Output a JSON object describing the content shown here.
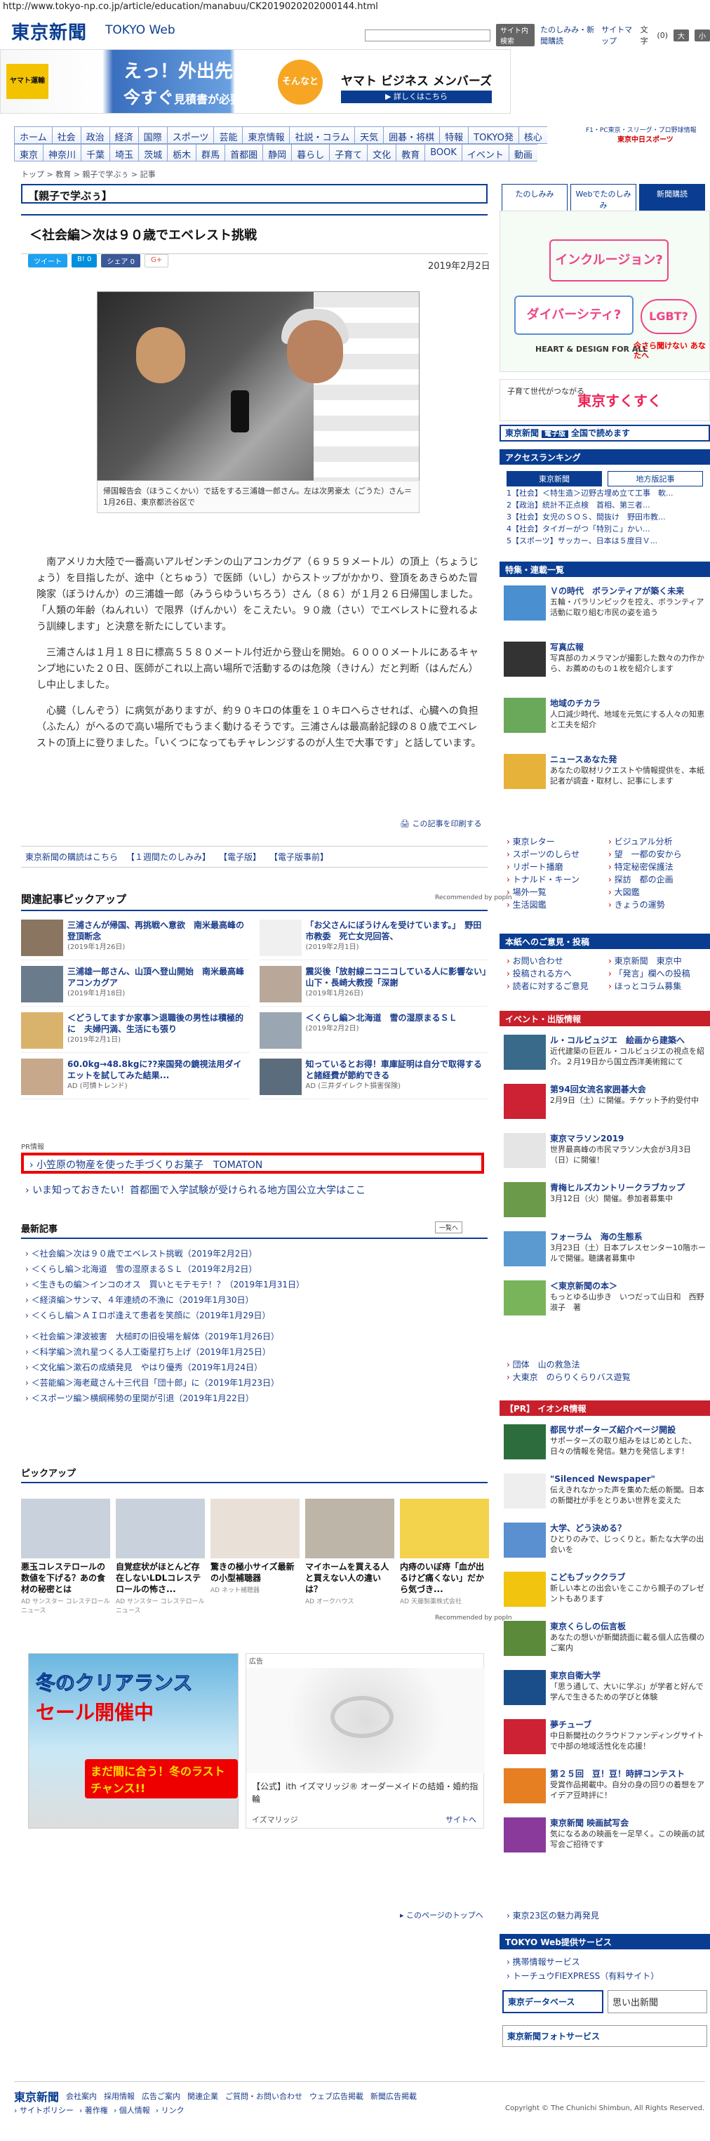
{
  "url": "http://www.tokyo-np.co.jp/article/education/manabuu/CK2019020202000144.html",
  "header": {
    "logo": "東京新聞",
    "logo_sub": "TOKYO Web",
    "search_btn": "サイト内検索",
    "links": [
      "たのしみみ・新聞購読",
      "サイトマップ",
      "文字",
      "大",
      "小"
    ],
    "font_size_count": "(0)"
  },
  "ad_top": {
    "brand": "ヤマト運輸",
    "line1": "えっ！外出先なのに、",
    "line2": "今すぐ",
    "line2b": "見積書が必要!?",
    "badge": "そんなときは...",
    "right": "ヤマト ビジネス メンバーズ",
    "cta": "▶ 詳しくはこちら"
  },
  "nav": {
    "row1": [
      "ホーム",
      "社会",
      "政治",
      "経済",
      "国際",
      "スポーツ",
      "芸能",
      "東京情報",
      "社説・コラム",
      "天気",
      "囲碁・将棋",
      "特報",
      "TOKYO発",
      "核心"
    ],
    "row2": [
      "東京",
      "神奈川",
      "千葉",
      "埼玉",
      "茨城",
      "栃木",
      "群馬",
      "首都圏",
      "静岡",
      "暮らし",
      "子育て",
      "文化",
      "教育",
      "BOOK",
      "イベント",
      "動画"
    ],
    "side": "F1・PC東京・スリーグ・プロ野球情報",
    "chunichi": "東京中日スポーツ"
  },
  "breadcrumb": "トップ > 教育 > 親子で学ぶぅ > 記事",
  "section_title": "【親子で学ぶぅ】",
  "right_tabs": [
    "たのしみみ",
    "Webでたのしみみ",
    "新聞購読"
  ],
  "article": {
    "title": "＜社会編＞次は９０歳でエベレスト挑戦",
    "date": "2019年2月2日",
    "share": [
      "ツイート",
      "B! 0",
      "シェア 0",
      "G+"
    ],
    "caption": "帰国報告会（ほうこくかい）で話をする三浦雄一郎さん。左は次男豪太（ごうた）さん＝1月26日、東京都渋谷区で",
    "paragraphs": [
      "南アメリカ大陸で一番高いアルゼンチンの山アコンカグア（６９５９メートル）の頂上（ちょうじょう）を目指したが、途中（とちゅう）で医師（いし）からストップがかかり、登頂をあきらめた冒険家（ぼうけんか）の三浦雄一郎（みうらゆういちろう）さん（８６）が１月２６日帰国しました。「人類の年齢（ねんれい）で限界（げんかい）をこえたい。９０歳（さい）でエベレストに登れるよう訓練します」と決意を新たにしています。",
      "三浦さんは１月１８日に標高５５８０メートル付近から登山を開始。６０００メートルにあるキャンプ地にいた２０日、医師がこれ以上高い場所で活動するのは危険（きけん）だと判断（はんだん）し中止しました。",
      "心臓（しんぞう）に病気がありますが、約９０キロの体重を１０キロへらさせれば、心臓への負担（ふたん）がへるので高い場所でもうまく動けるそうです。三浦さんは最高齢記録の８０歳でエベレストの頂上に登りました。「いくつになってもチャレンジするのが人生で大事です」と話しています。"
    ],
    "print": "この記事を印刷する"
  },
  "subbar": [
    "東京新聞の購読はこちら",
    "【１週間たのしみみ】",
    "【電子版】",
    "【電子版事前】"
  ],
  "pickup": {
    "heading": "関連記事ピックアップ",
    "recommended": "Recommended by popIn",
    "items": [
      {
        "title": "三浦さんが帰国、再挑戦へ意欲　南米最高峰の登頂断念",
        "date": "(2019年1月26日)"
      },
      {
        "title": "「お父さんにぼうけんを受けています。」　野田市教委　死亡女児回答、",
        "date": "(2019年2月1日)"
      },
      {
        "title": "三浦雄一郎さん、山頂へ登山開始　南米最高峰アコンカグア",
        "date": "(2019年1月18日)"
      },
      {
        "title": "震災後「放射線ニコニコしている人に影響ない」　山下・長崎大教授「深謝",
        "date": "(2019年1月26日)"
      },
      {
        "title": "＜どうしてますか家事＞退職後の男性は積極的に　夫婦円満、生活にも張り",
        "date": "(2019年2月1日)"
      },
      {
        "title": "＜くらし編＞北海道　雪の湿原まるＳＬ",
        "date": "(2019年2月2日)"
      },
      {
        "title": "60.0kg→48.8kgに??来国発の鏡視法用ダイエットを試してみた結果...",
        "date": "AD (可憐トレンド)"
      },
      {
        "title": "知っているとお得！車庫証明は自分で取得すると諸経費が節約できる",
        "date": "AD (三井ダイレクト損害保険)"
      }
    ]
  },
  "pr": {
    "label": "PR情報",
    "ad1": "小笠原の物産を使った手づくりお菓子　TOMATON",
    "ad2": "いま知っておきたい！首都圏で入学試験が受けられる地方国公立大学はここ"
  },
  "latest": {
    "heading": "最新記事",
    "more": "一覧へ",
    "items": [
      "＜社会編＞次は９０歳でエベレスト挑戦（2019年2月2日）",
      "＜くらし編＞北海道　雪の湿原まるＳＬ（2019年2月2日）",
      "＜生きもの編＞インコのオス　買いとモテモテ！？（2019年1月31日）",
      "＜経済編＞サンマ、４年連続の不漁に（2019年1月30日）",
      "＜くらし編＞ＡＩロボ逢えて患者を笑顔に（2019年1月29日）",
      "＜社会編＞津波被害　大槌町の旧役場を解体（2019年1月26日）",
      "＜科学編＞流れ星つくる人工衛星打ち上げ（2019年1月25日）",
      "＜文化編＞漱石の成績発見　やはり優秀（2019年1月24日）",
      "＜芸能編＞海老蔵さん十三代目「団十郎」に（2019年1月23日）",
      "＜スポーツ編＞横綱稀勢の里関が引退（2019年1月22日）"
    ]
  },
  "pickup2": {
    "heading": "ピックアップ",
    "recommended": "Recommended by popIn",
    "items": [
      {
        "title": "悪玉コレステロールの数値を下げる？あの食材の秘密とは",
        "src": "AD サンスター コレステロールニュース"
      },
      {
        "title": "自覚症状がほとんど存在しないLDLコレステロールの怖さ...",
        "src": "AD サンスター コレステロールニュース"
      },
      {
        "title": "驚きの極小サイズ最新の小型補聴器",
        "src": "AD ネット補聴器"
      },
      {
        "title": "マイホームを買える人と買えない人の違いは？",
        "src": "AD オークハウス"
      },
      {
        "title": "内痔のいぼ痔「血が出るけど痛くない」だから気づき...",
        "src": "AD 天藤製薬株式会社"
      }
    ]
  },
  "ad_bottom": {
    "left1": "冬のクリアランス",
    "left2": "セール開催中",
    "left3": "まだ間に合う！冬のラストチャンス!!",
    "label": "広告",
    "right_title": "【公式】ith イズマリッジ® オーダーメイドの結婚・婚約指輪",
    "right_sponsor": "イズマリッジ",
    "right_link": "サイトへ"
  },
  "totop": "このページのトップへ",
  "right": {
    "ban1": [
      "インクルージョン?",
      "ダイバーシティ?",
      "LGBT?"
    ],
    "ban1_foot": "HEART & DESIGN FOR ALL",
    "ban1_foot2": "今さら聞けない あなたへ",
    "ban2a": "子育て世代がつながる",
    "ban2b": "東京すくすく",
    "ban3": "東京新聞",
    "ban3x": "電子版",
    "ban3y": "全国で読めます",
    "ranking_h": "アクセスランキング",
    "ranking_tabs": [
      "東京新聞",
      "地方版記事"
    ],
    "ranking": [
      "1【社会】＜特生造＞辺野古埋め立て工事　軟...",
      "2【政治】統計不正点検　首相、第三者...",
      "3【社会】女児のＳＯＳ、間抜け　野田市教...",
      "4【社会】タイガーがつ「特別こ」かい...",
      "5【スポーツ】サッカー、日本は５度目Ｖ..."
    ],
    "special_h": "特集・連載一覧",
    "special": [
      {
        "t": "Ｖの時代　ボランティアが築く未来",
        "d": "五輪・パラリンピックを控え、ボランティア活動に取り組む市民の姿を追う"
      },
      {
        "t": "写真広報",
        "d": "写真部のカメラマンが撮影した数々の力作から、お薦めのもの１枚を紹介します"
      },
      {
        "t": "地域のチカラ",
        "d": "人口減少時代、地域を元気にする人々の知恵と工夫を紹介"
      },
      {
        "t": "ニュースあなた発",
        "d": "あなたの取材リクエストや情報提供を、本紙記者が調査・取材し、記事にします"
      }
    ],
    "links1": [
      "東京レター",
      "ビジュアル分析",
      "スポーツのしらせ",
      "望　一都の安から",
      "リポート播磨",
      "特定秘密保護法",
      "トナルド・キーン",
      "探訪　都の企画",
      "場外一覧",
      "大図鑑",
      "生活図鑑",
      "きょうの運勢"
    ],
    "info_h": "本紙へのご意見・投稿",
    "info": [
      "お問い合わせ",
      "東京新聞　東京中",
      "投稿される方へ",
      "「発言」欄への投稿",
      "読者に対するご意見",
      "ほっとコラム募集"
    ],
    "event_h": "イベント・出版情報",
    "events": [
      {
        "t": "ル・コルビュジエ　絵画から建築へ",
        "d": "近代建築の巨匠ル・コルビュジエの視点を紹介。２月19日から国立西洋美術館にて"
      },
      {
        "t": "第94回女流名家囲碁大会",
        "d": "2月9日（土）に開催。チケット予約受付中"
      },
      {
        "t": "東京マラソン2019",
        "d": "世界最高峰の市民マラソン大会が3月3日（日）に開催！"
      },
      {
        "t": "青梅ヒルズカントリークラブカップ",
        "d": "3月12日（火）開催。参加者募集中"
      },
      {
        "t": "フォーラム　海の生態系",
        "d": "3月23日（土）日本プレスセンター10階ホールで開催。聴講者募集中"
      },
      {
        "t": "＜東京新聞の本＞",
        "d": "もっとゆる山歩き　いつだって山日和　西野淑子　著"
      }
    ],
    "ev_links": [
      "団体　山の救急法",
      "大東京　のらりくらりバス遊覧"
    ],
    "pr_h": "【PR】 イオンR情報",
    "prs": [
      {
        "t": "都民サポーターズ紹介ページ開設",
        "d": "サポーターズの取り組みをはじめとした、日々の情報を発信。魅力を発信します！"
      },
      {
        "t": "\"Silenced Newspaper\"",
        "d": "伝えきれなかった声を集めた紙の新聞。日本の新聞社が手をとりあい世界を変えた"
      },
      {
        "t": "大学、どう決める？",
        "d": "ひとりのみで、じっくりと。新たな大学の出会いを"
      },
      {
        "t": "こどもブッククラブ",
        "d": "新しい本との出会いをここから親子のプレゼントもあります"
      },
      {
        "t": "東京くらしの伝言板",
        "d": "あなたの想いが新聞読面に載る個人広告欄のご案内"
      },
      {
        "t": "東京自衛大学",
        "d": "「思う通して、大いに学ぶ」が学者と好んで学んで生きるための学びと体験"
      },
      {
        "t": "夢チューブ",
        "d": "中日新聞社のクラウドファンディングサイトで中部の地域活性化を応援！"
      },
      {
        "t": "第２５回　豆！豆！時評コンテスト",
        "d": "受賞作品掲載中。自分の身の回りの着想をアイデア豆時評に！"
      },
      {
        "t": "東京新聞 映画試写会",
        "d": "気になるあの映画を一足早く。この映画の試写会ご招待です"
      }
    ],
    "pr_more": "東京23区の魅力再発見",
    "svc_h": "TOKYO Web提供サービス",
    "svc": [
      "携帯情報サービス",
      "トーチュウFIEXPRESS（有料サイト）"
    ],
    "db": "東京データベース",
    "omoide": "思い出新聞",
    "photo": "東京新聞フォトサービス"
  },
  "footer": {
    "logo": "東京新聞",
    "links": [
      "会社案内",
      "採用情報",
      "広告ご案内",
      "関連企業",
      "ご質問・お問い合わせ",
      "ウェブ広告掲載",
      "新聞広告掲載"
    ],
    "links2": [
      "サイトポリシー",
      "著作権",
      "個人情報",
      "リンク"
    ],
    "copyright": "Copyright © The Chunichi Shimbun, All Rights Reserved."
  }
}
